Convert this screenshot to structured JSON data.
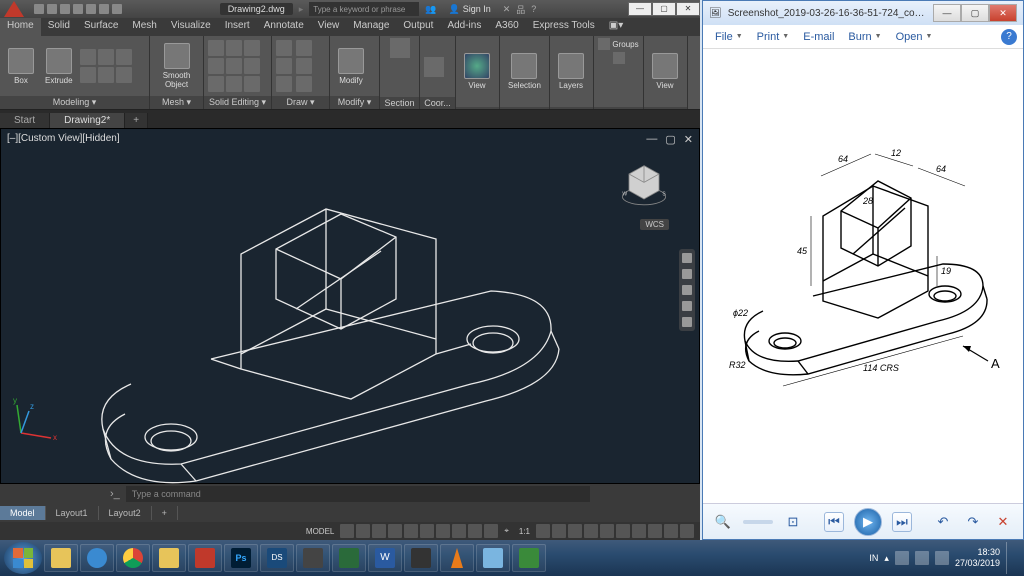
{
  "autocad": {
    "filename": "Drawing2.dwg",
    "search_placeholder": "Type a keyword or phrase",
    "signin": "Sign In",
    "ribbon_tabs": [
      "Home",
      "Solid",
      "Surface",
      "Mesh",
      "Visualize",
      "Insert",
      "Annotate",
      "View",
      "Manage",
      "Output",
      "Add-ins",
      "A360",
      "Express Tools"
    ],
    "panels": {
      "modeling_title": "Modeling ▾",
      "box": "Box",
      "extrude": "Extrude",
      "smooth": "Smooth Object",
      "mesh_title": "Mesh ▾",
      "solidediting_title": "Solid Editing ▾",
      "draw_title": "Draw ▾",
      "modify": "Modify",
      "modify_title": "Modify ▾",
      "section": "Section",
      "coor": "Coor...",
      "view_btn": "View",
      "selection": "Selection",
      "layers": "Layers",
      "groups": "Groups",
      "view2": "View"
    },
    "doc_tabs": {
      "start": "Start",
      "active": "Drawing2*"
    },
    "view_label": "[–][Custom View][Hidden]",
    "wcs": "WCS",
    "cmd_placeholder": "Type a command",
    "layout_tabs": {
      "model": "Model",
      "l1": "Layout1",
      "l2": "Layout2"
    },
    "status": {
      "model": "MODEL",
      "scale": "1:1"
    }
  },
  "picture_viewer": {
    "title": "Screenshot_2019-03-26-16-36-51-724_com.google...",
    "menu": {
      "file": "File",
      "print": "Print",
      "email": "E-mail",
      "burn": "Burn",
      "open": "Open"
    },
    "drawing": {
      "dim1": "64",
      "dim2": "12",
      "dim3": "64",
      "dim4": "28",
      "dim5": "45",
      "dim6": "19",
      "dia": "ϕ22",
      "r": "R32",
      "crs": "114 CRS",
      "arrow": "A"
    }
  },
  "taskbar": {
    "lang": "IN",
    "time": "18:30",
    "date": "27/03/2019"
  }
}
